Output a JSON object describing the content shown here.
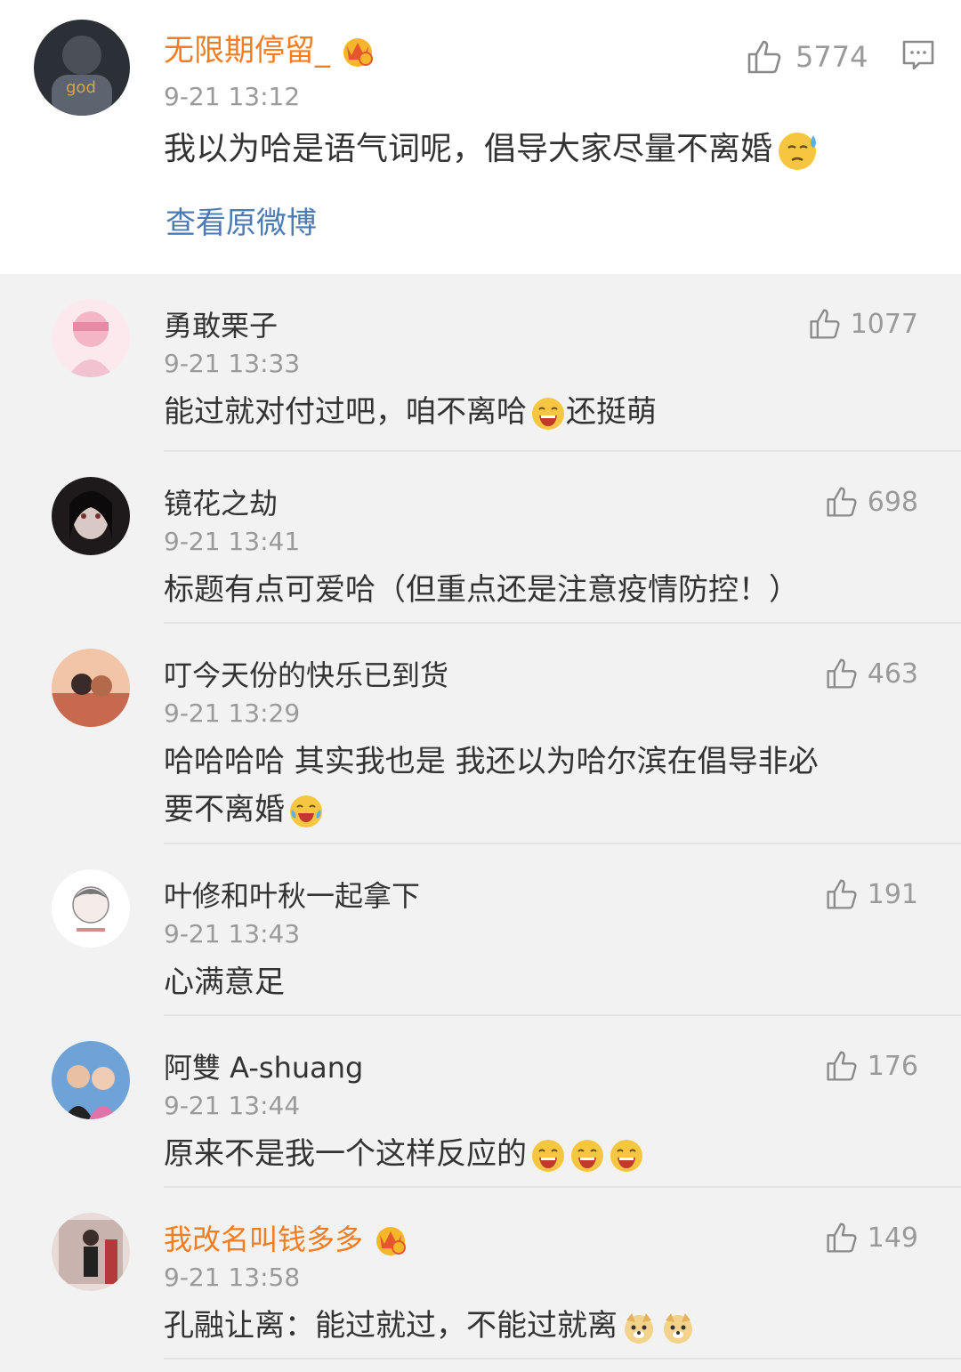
{
  "post": {
    "author": "无限期停留_",
    "time": "9-21 13:12",
    "text": "我以为哈是语气词呢，倡导大家尽量不离婚",
    "likes": "5774",
    "view_original": "查看原微博",
    "text_emoji": "sweat-emoji",
    "like_icon": "thumbs-up-icon",
    "reply_icon": "comment-icon"
  },
  "comments": [
    {
      "author": "勇敢栗子",
      "time": "9-21 13:33",
      "text": "能过就对付过吧，咱不离哈",
      "text_tail": "还挺萌",
      "likes": "1077"
    },
    {
      "author": "镜花之劫",
      "time": "9-21 13:41",
      "text": "标题有点可爱哈（但重点还是注意疫情防控！）",
      "likes": "698"
    },
    {
      "author": "叮今天份的快乐已到货",
      "time": "9-21 13:29",
      "text_line1": "哈哈哈哈  其实我也是  我还以为哈尔滨在倡导非必",
      "text_line2": "要不离婚",
      "likes": "463"
    },
    {
      "author": "叶修和叶秋一起拿下",
      "time": "9-21 13:43",
      "text": "心满意足",
      "likes": "191"
    },
    {
      "author": "阿雙 A-shuang",
      "time": "9-21 13:44",
      "text": "原来不是我一个这样反应的",
      "likes": "176"
    },
    {
      "author": "我改名叫钱多多",
      "time": "9-21 13:58",
      "text": "孔融让离：能过就过，不能过就离",
      "likes": "149"
    }
  ],
  "colors": {
    "vip_name": "#f27d22",
    "link": "#4d7bb4",
    "meta": "#9a9a9a",
    "background": "#f2f2f2"
  }
}
